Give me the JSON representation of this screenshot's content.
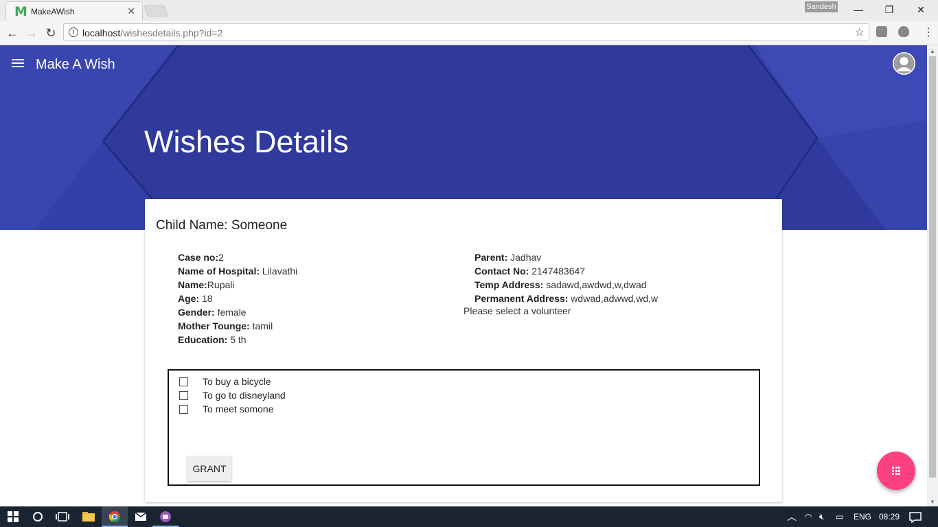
{
  "browser": {
    "tab_title": "MakeAWish",
    "tab_logo": "M",
    "profile_name": "Sandesh",
    "url_host": "localhost",
    "url_path": "/wishesdetails.php?id=2"
  },
  "app": {
    "brand": "Make A Wish",
    "page_title": "Wishes Details",
    "header_color": "#2f3a9c",
    "fab_color": "#ff4081"
  },
  "child": {
    "name_label": "Child Name: Someone",
    "left_fields": [
      {
        "label": "Case no:",
        "value": "2"
      },
      {
        "label": "Name of Hospital:",
        "value": " Lilavathi"
      },
      {
        "label": "Name:",
        "value": "Rupali"
      },
      {
        "label": "Age:",
        "value": " 18"
      },
      {
        "label": "Gender:",
        "value": " female"
      },
      {
        "label": "Mother Tounge:",
        "value": " tamil"
      },
      {
        "label": "Education:",
        "value": " 5 th"
      }
    ],
    "right_fields": [
      {
        "label": "Parent:",
        "value": " Jadhav"
      },
      {
        "label": "Contact No:",
        "value": " 2147483647"
      },
      {
        "label": "Temp Address:",
        "value": " sadawd,awdwd,w,dwad"
      },
      {
        "label": "Permanent Address:",
        "value": " wdwad,adwwd,wd,w"
      }
    ],
    "volunteer_note": "Please select a volunteer"
  },
  "wishes": [
    {
      "text": "To buy a bicycle",
      "checked": false
    },
    {
      "text": "To go to disneyland",
      "checked": false
    },
    {
      "text": "To meet somone",
      "checked": false
    }
  ],
  "grant_label": "GRANT",
  "taskbar": {
    "language": "ENG",
    "time": "08:29"
  },
  "icons": [
    "menu-icon",
    "avatar-icon",
    "apps-grid-icon",
    "back-icon",
    "forward-icon",
    "reload-icon",
    "info-icon",
    "star-icon",
    "windows-start-icon",
    "search-circle-icon",
    "task-view-icon",
    "file-explorer-icon",
    "chrome-icon",
    "mail-icon",
    "app-icon",
    "notification-icon"
  ]
}
